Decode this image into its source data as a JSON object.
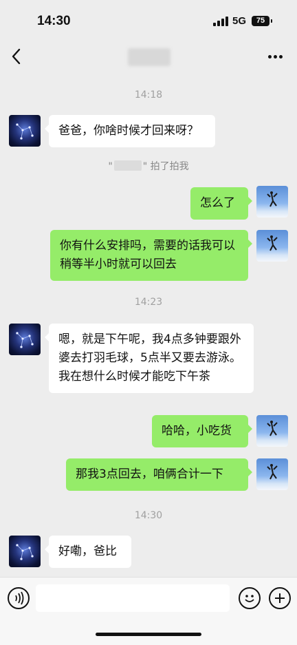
{
  "status": {
    "time": "14:30",
    "network": "5G",
    "battery": "75"
  },
  "nav": {
    "back_icon": "chevron-left-icon",
    "more_icon": "more-dots-icon"
  },
  "messages": {
    "ts1": "14:18",
    "m1": "爸爸，你啥时候才回来呀？",
    "pat_prefix": "\"",
    "pat_suffix": "\" 拍了拍我",
    "m2": "怎么了",
    "m3": "你有什么安排吗，需要的话我可以稍等半小时就可以回去",
    "ts2": "14:23",
    "m4": "嗯，就是下午呢，我4点多钟要跟外婆去打羽毛球，5点半又要去游泳。我在想什么时候才能吃下午茶",
    "m5": "哈哈，小吃货",
    "m6": "那我3点回去，咱俩合计一下",
    "ts3": "14:30",
    "m7": "好嘞，爸比"
  },
  "input": {
    "value": ""
  }
}
